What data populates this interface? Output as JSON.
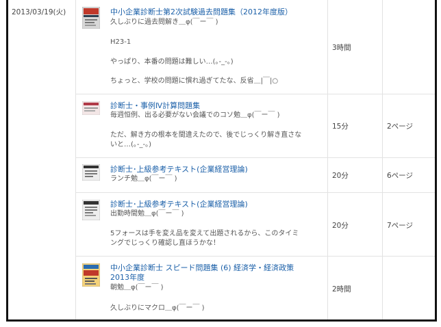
{
  "date": "2013/03/19(火)",
  "entries": [
    {
      "title": "中小企業診断士第2次試験過去問題集（2012年度版）",
      "lines": [
        "久しぶりに過去問解き＿φ(￣ー￣ )",
        "H23-1",
        "やっぱり、本番の問題は難しい…(｡-_-｡)",
        "ちょっと、学校の問題に慣れ過ぎてたな、反省＿|￣|○"
      ],
      "time": "3時間",
      "pages": ""
    },
    {
      "title": "診断士・事例Ⅳ計算問題集",
      "lines": [
        "毎週恒例、出る必要がない会議でのコソ勉＿φ(￣ー￣ )",
        "ただ、解き方の根本を間違えたので、後でじっくり解き直さな",
        "いと…(｡-_-｡)"
      ],
      "time": "15分",
      "pages": "2ページ"
    },
    {
      "title": "診断士･上級参考テキスト(企業経営理論)",
      "lines": [
        "ランチ勉＿φ(￣ー￣ )"
      ],
      "time": "20分",
      "pages": "6ページ"
    },
    {
      "title": "診断士･上級参考テキスト(企業経営理論)",
      "lines": [
        "出勤時間勉＿φ(￣ー￣ )",
        "5フォースは手を変え品を変えて出題されるから、このタイミ",
        "ングでじっくり確認し直ほうかな！"
      ],
      "time": "20分",
      "pages": "7ページ"
    },
    {
      "title": "中小企業診断士 スピード問題集 (6) 経済学・経済政策",
      "title2": "2013年度",
      "lines": [
        "朝勉＿φ(￣ー￣ )",
        "久しぶりにマクロ＿φ(￣ー￣ )"
      ],
      "time": "2時間",
      "pages": ""
    }
  ],
  "colors": {
    "link": "#1a5fa8",
    "text": "#555555",
    "grid": "#e2e2e2",
    "frame": "#111111"
  }
}
